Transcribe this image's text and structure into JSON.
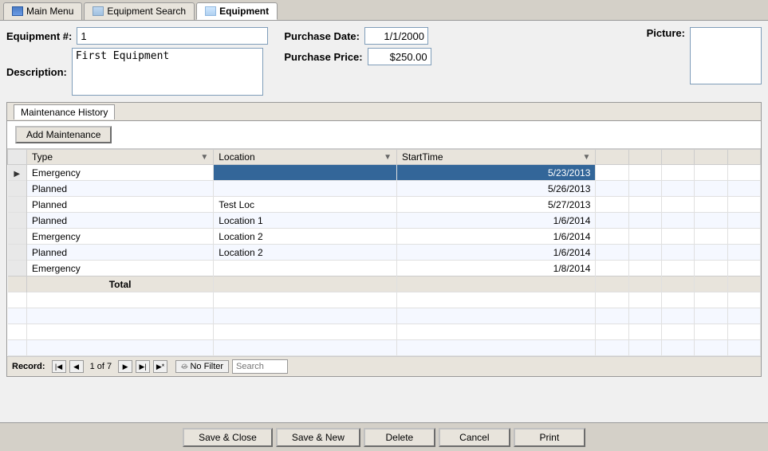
{
  "tabs": [
    {
      "id": "main-menu",
      "label": "Main Menu",
      "iconType": "grid",
      "active": false
    },
    {
      "id": "equipment-search",
      "label": "Equipment Search",
      "iconType": "search",
      "active": false
    },
    {
      "id": "equipment",
      "label": "Equipment",
      "iconType": "eq",
      "active": true
    }
  ],
  "form": {
    "equipment_num_label": "Equipment #:",
    "equipment_num_value": "1",
    "description_label": "Description:",
    "description_value": "First Equipment",
    "purchase_date_label": "Purchase Date:",
    "purchase_date_value": "1/1/2000",
    "purchase_price_label": "Purchase Price:",
    "purchase_price_value": "$250.00",
    "picture_label": "Picture:"
  },
  "tab_panel": {
    "title": "Maintenance History"
  },
  "add_btn_label": "Add Maintenance",
  "table": {
    "columns": [
      {
        "id": "type",
        "label": "Type"
      },
      {
        "id": "location",
        "label": "Location"
      },
      {
        "id": "starttime",
        "label": "StartTime"
      }
    ],
    "rows": [
      {
        "type": "Emergency",
        "location": "",
        "starttime": "5/23/2013",
        "selected": true
      },
      {
        "type": "Planned",
        "location": "",
        "starttime": "5/26/2013",
        "selected": false
      },
      {
        "type": "Planned",
        "location": "Test Loc",
        "starttime": "5/27/2013",
        "selected": false
      },
      {
        "type": "Planned",
        "location": "Location 1",
        "starttime": "1/6/2014",
        "selected": false
      },
      {
        "type": "Emergency",
        "location": "Location 2",
        "starttime": "1/6/2014",
        "selected": false
      },
      {
        "type": "Planned",
        "location": "Location 2",
        "starttime": "1/6/2014",
        "selected": false
      },
      {
        "type": "Emergency",
        "location": "",
        "starttime": "1/8/2014",
        "selected": false
      }
    ],
    "total_label": "Total"
  },
  "record_nav": {
    "label": "Record:",
    "current": "1 of 7",
    "no_filter": "No Filter",
    "search_placeholder": "Search"
  },
  "bottom_buttons": [
    {
      "id": "save-close",
      "label": "Save & Close"
    },
    {
      "id": "save-new",
      "label": "Save & New"
    },
    {
      "id": "delete",
      "label": "Delete"
    },
    {
      "id": "cancel",
      "label": "Cancel"
    },
    {
      "id": "print",
      "label": "Print"
    }
  ]
}
